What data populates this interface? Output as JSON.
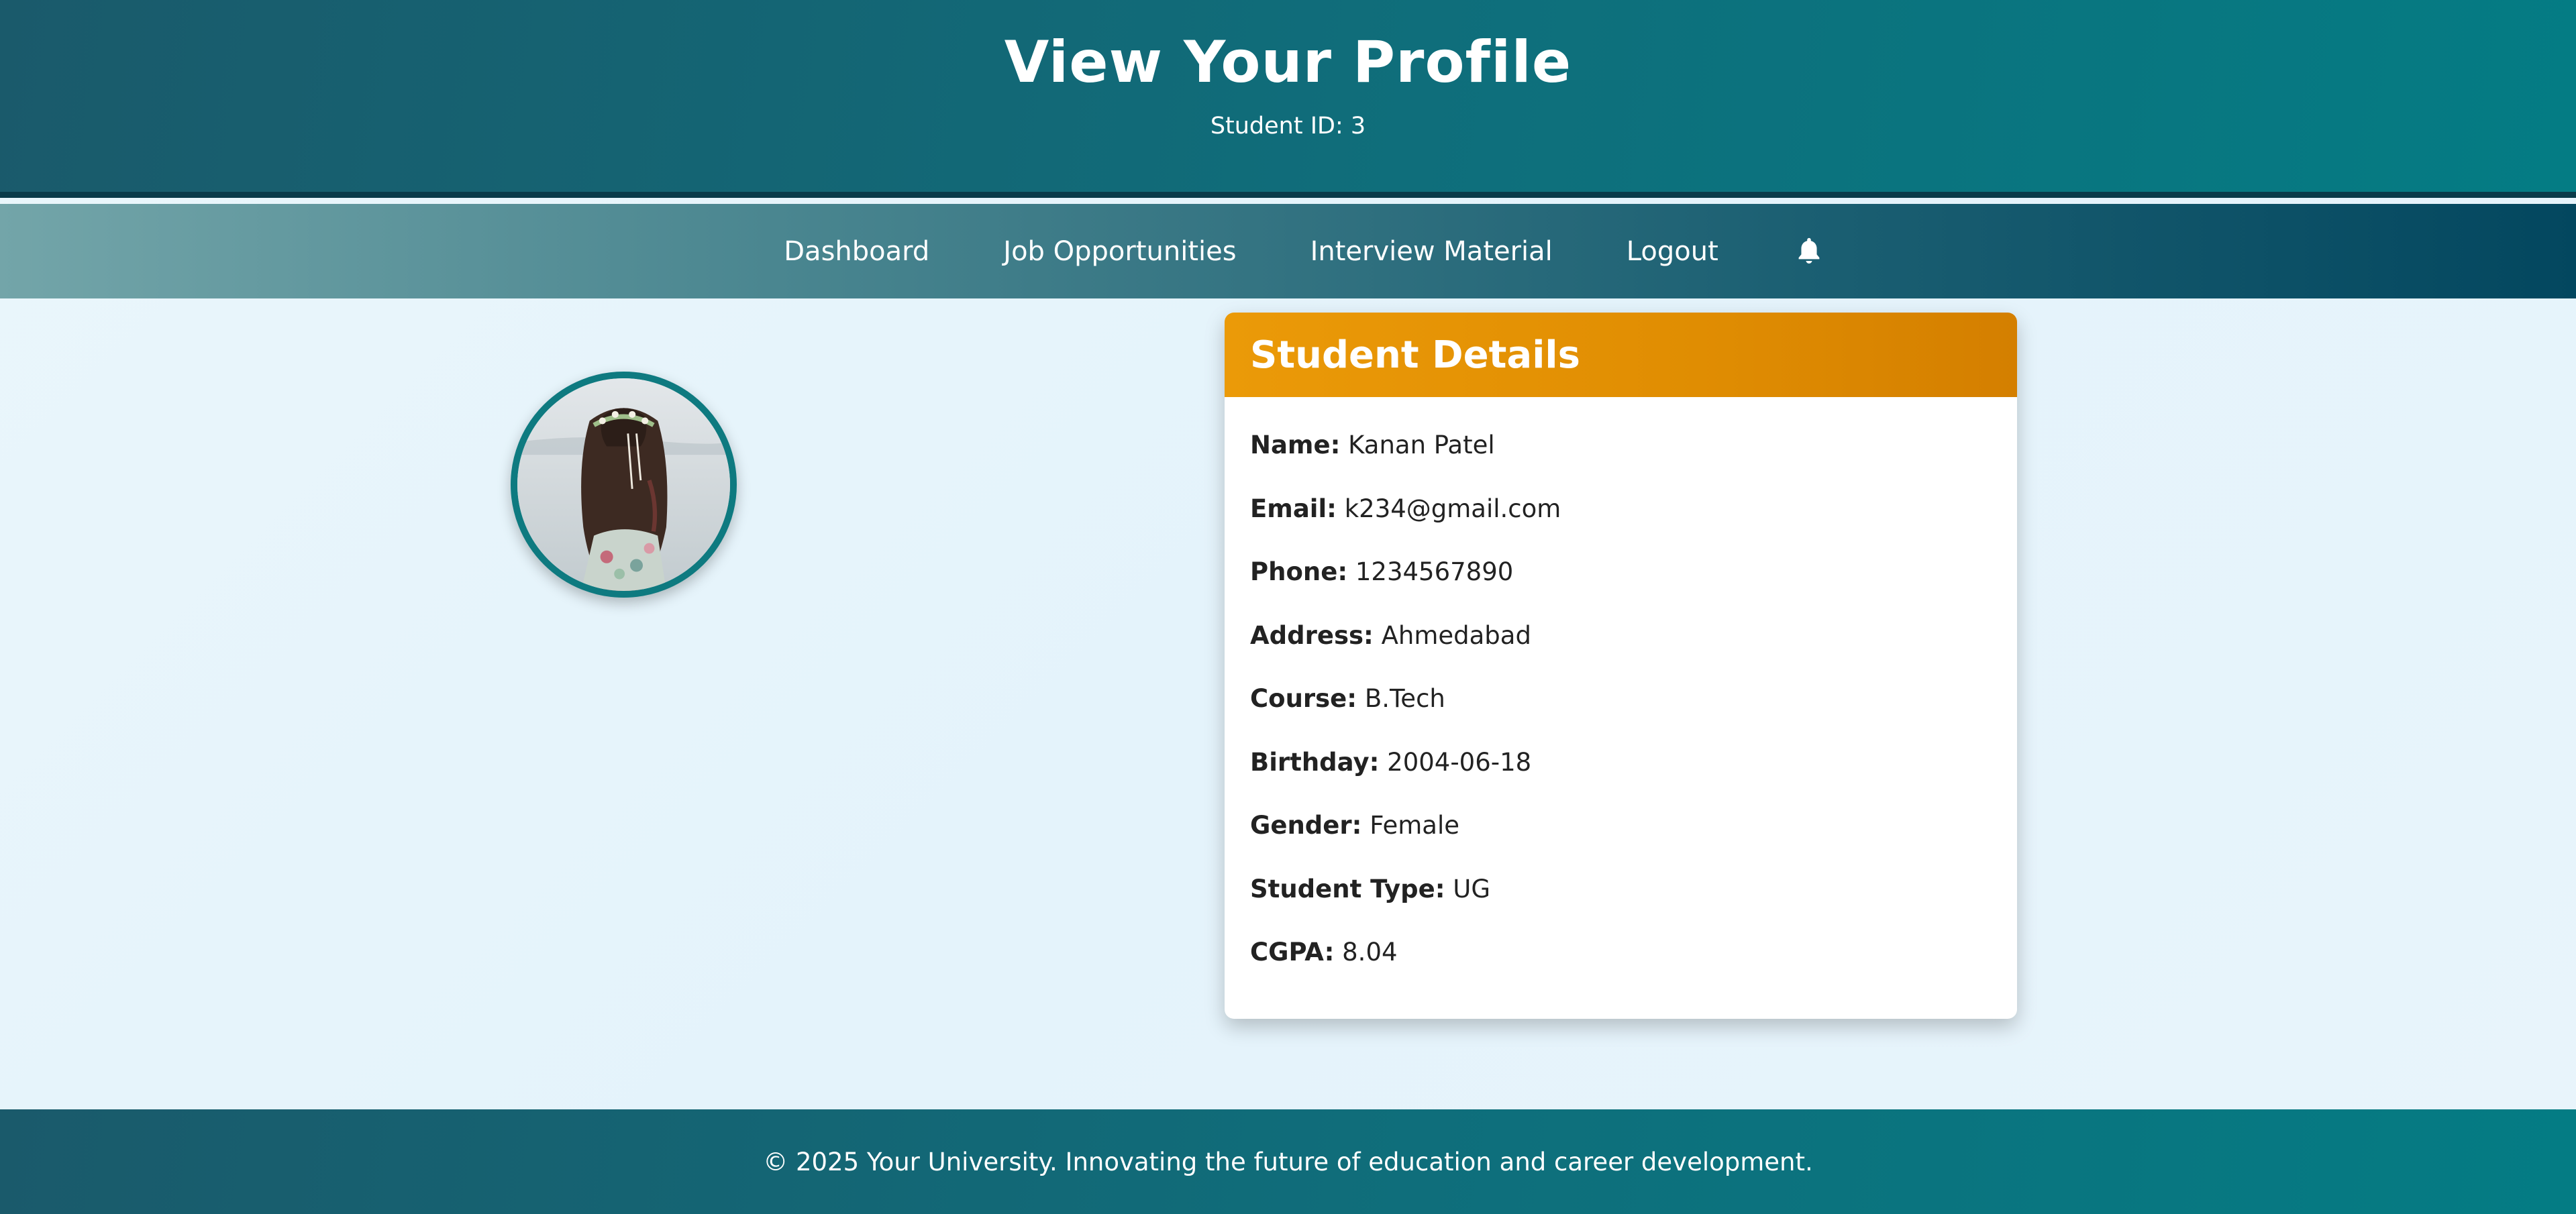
{
  "header": {
    "title": "View Your Profile",
    "student_id": "Student ID: 3"
  },
  "nav": {
    "items": [
      {
        "label": "Dashboard"
      },
      {
        "label": "Job Opportunities"
      },
      {
        "label": "Interview Material"
      },
      {
        "label": "Logout"
      }
    ],
    "bell_icon": "bell-icon"
  },
  "profile": {
    "avatar_icon": "profile-photo"
  },
  "details": {
    "title": "Student Details",
    "rows": [
      {
        "label": "Name:",
        "value": "Kanan Patel"
      },
      {
        "label": "Email:",
        "value": "k234@gmail.com"
      },
      {
        "label": "Phone:",
        "value": "1234567890"
      },
      {
        "label": "Address:",
        "value": "Ahmedabad"
      },
      {
        "label": "Course:",
        "value": "B.Tech"
      },
      {
        "label": "Birthday:",
        "value": "2004-06-18"
      },
      {
        "label": "Gender:",
        "value": "Female"
      },
      {
        "label": "Student Type:",
        "value": "UG"
      },
      {
        "label": "CGPA:",
        "value": "8.04"
      }
    ]
  },
  "footer": {
    "text": "© 2025 Your University. Innovating the future of education and career development."
  },
  "colors": {
    "header_teal": "#0f6e7b",
    "accent_orange": "#e08d02",
    "avatar_border": "#0e7a80"
  }
}
